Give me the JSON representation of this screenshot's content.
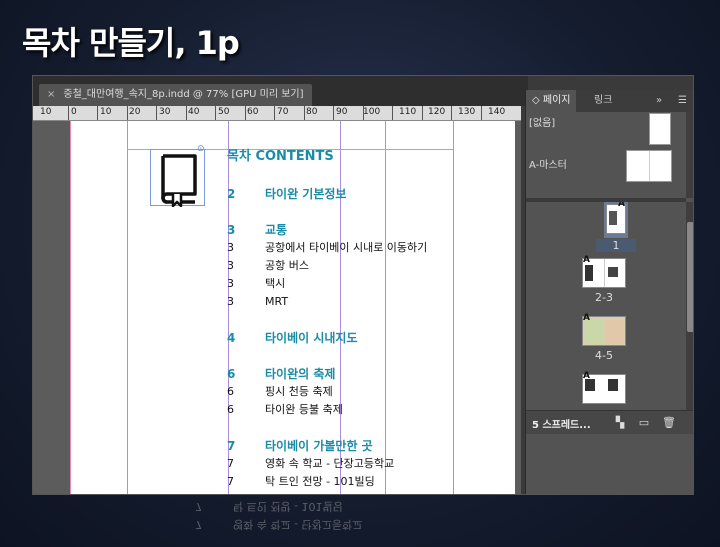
{
  "slide": {
    "title": "목차 만들기, 1p"
  },
  "document": {
    "tab_close": "×",
    "tab_title": "중철_대만여행_속지_8p.indd @ 77% [GPU 미리 보기]"
  },
  "ruler": {
    "labels": [
      "10",
      "0",
      "10",
      "20",
      "30",
      "40",
      "50",
      "60",
      "70",
      "80",
      "90",
      "100",
      "110",
      "120",
      "130",
      "140"
    ]
  },
  "toc": {
    "title": "목차 CONTENTS",
    "sections": [
      {
        "num": "2",
        "title": "타이완 기본정보",
        "items": []
      },
      {
        "num": "3",
        "title": "교통",
        "items": [
          {
            "num": "3",
            "text": "공항에서 타이베이 시내로 이동하기"
          },
          {
            "num": "3",
            "text": "공항 버스"
          },
          {
            "num": "3",
            "text": "택시"
          },
          {
            "num": "3",
            "text": "MRT"
          }
        ]
      },
      {
        "num": "4",
        "title": "타이베이 시내지도",
        "items": []
      },
      {
        "num": "6",
        "title": "타이완의 축제",
        "items": [
          {
            "num": "6",
            "text": "핑시 천등 축제"
          },
          {
            "num": "6",
            "text": "타이완 등불 축제"
          }
        ]
      },
      {
        "num": "7",
        "title": "타이베이 가볼만한 곳",
        "items": [
          {
            "num": "7",
            "text": "영화 속 학교 - 단장고등학교"
          },
          {
            "num": "7",
            "text": "탁 트인 전망 - 101빌딩"
          }
        ]
      }
    ]
  },
  "panel": {
    "tab_pages": "페이지",
    "tab_links": "링크",
    "tab_more": "»",
    "menu_icon": "menu-icon",
    "masters": [
      {
        "label": "[없음]"
      },
      {
        "label": "A-마스터"
      }
    ],
    "pages": [
      {
        "label": "1",
        "badge": "A"
      },
      {
        "label": "2-3",
        "badge": "A"
      },
      {
        "label": "4-5",
        "badge": "A"
      },
      {
        "label": "",
        "badge": "A"
      }
    ],
    "footer_label": "5 스프레드..."
  },
  "reflection": {
    "rows": [
      {
        "num": "7",
        "text": "탁 트인 전망 - 101빌딩"
      },
      {
        "num": "7",
        "text": "영화 속 학교 - 단장고등학교"
      }
    ]
  },
  "colors": {
    "accent": "#1a8ca8",
    "guide_pink": "#e58bb6",
    "guide_purple": "#a98fe0"
  }
}
